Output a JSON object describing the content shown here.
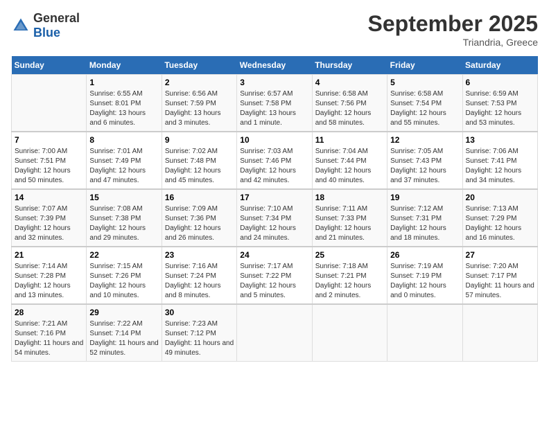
{
  "logo": {
    "general": "General",
    "blue": "Blue"
  },
  "title": "September 2025",
  "location": "Triandria, Greece",
  "days_of_week": [
    "Sunday",
    "Monday",
    "Tuesday",
    "Wednesday",
    "Thursday",
    "Friday",
    "Saturday"
  ],
  "weeks": [
    [
      {
        "day": "",
        "sunrise": "",
        "sunset": "",
        "daylight": ""
      },
      {
        "day": "1",
        "sunrise": "Sunrise: 6:55 AM",
        "sunset": "Sunset: 8:01 PM",
        "daylight": "Daylight: 13 hours and 6 minutes."
      },
      {
        "day": "2",
        "sunrise": "Sunrise: 6:56 AM",
        "sunset": "Sunset: 7:59 PM",
        "daylight": "Daylight: 13 hours and 3 minutes."
      },
      {
        "day": "3",
        "sunrise": "Sunrise: 6:57 AM",
        "sunset": "Sunset: 7:58 PM",
        "daylight": "Daylight: 13 hours and 1 minute."
      },
      {
        "day": "4",
        "sunrise": "Sunrise: 6:58 AM",
        "sunset": "Sunset: 7:56 PM",
        "daylight": "Daylight: 12 hours and 58 minutes."
      },
      {
        "day": "5",
        "sunrise": "Sunrise: 6:58 AM",
        "sunset": "Sunset: 7:54 PM",
        "daylight": "Daylight: 12 hours and 55 minutes."
      },
      {
        "day": "6",
        "sunrise": "Sunrise: 6:59 AM",
        "sunset": "Sunset: 7:53 PM",
        "daylight": "Daylight: 12 hours and 53 minutes."
      }
    ],
    [
      {
        "day": "7",
        "sunrise": "Sunrise: 7:00 AM",
        "sunset": "Sunset: 7:51 PM",
        "daylight": "Daylight: 12 hours and 50 minutes."
      },
      {
        "day": "8",
        "sunrise": "Sunrise: 7:01 AM",
        "sunset": "Sunset: 7:49 PM",
        "daylight": "Daylight: 12 hours and 47 minutes."
      },
      {
        "day": "9",
        "sunrise": "Sunrise: 7:02 AM",
        "sunset": "Sunset: 7:48 PM",
        "daylight": "Daylight: 12 hours and 45 minutes."
      },
      {
        "day": "10",
        "sunrise": "Sunrise: 7:03 AM",
        "sunset": "Sunset: 7:46 PM",
        "daylight": "Daylight: 12 hours and 42 minutes."
      },
      {
        "day": "11",
        "sunrise": "Sunrise: 7:04 AM",
        "sunset": "Sunset: 7:44 PM",
        "daylight": "Daylight: 12 hours and 40 minutes."
      },
      {
        "day": "12",
        "sunrise": "Sunrise: 7:05 AM",
        "sunset": "Sunset: 7:43 PM",
        "daylight": "Daylight: 12 hours and 37 minutes."
      },
      {
        "day": "13",
        "sunrise": "Sunrise: 7:06 AM",
        "sunset": "Sunset: 7:41 PM",
        "daylight": "Daylight: 12 hours and 34 minutes."
      }
    ],
    [
      {
        "day": "14",
        "sunrise": "Sunrise: 7:07 AM",
        "sunset": "Sunset: 7:39 PM",
        "daylight": "Daylight: 12 hours and 32 minutes."
      },
      {
        "day": "15",
        "sunrise": "Sunrise: 7:08 AM",
        "sunset": "Sunset: 7:38 PM",
        "daylight": "Daylight: 12 hours and 29 minutes."
      },
      {
        "day": "16",
        "sunrise": "Sunrise: 7:09 AM",
        "sunset": "Sunset: 7:36 PM",
        "daylight": "Daylight: 12 hours and 26 minutes."
      },
      {
        "day": "17",
        "sunrise": "Sunrise: 7:10 AM",
        "sunset": "Sunset: 7:34 PM",
        "daylight": "Daylight: 12 hours and 24 minutes."
      },
      {
        "day": "18",
        "sunrise": "Sunrise: 7:11 AM",
        "sunset": "Sunset: 7:33 PM",
        "daylight": "Daylight: 12 hours and 21 minutes."
      },
      {
        "day": "19",
        "sunrise": "Sunrise: 7:12 AM",
        "sunset": "Sunset: 7:31 PM",
        "daylight": "Daylight: 12 hours and 18 minutes."
      },
      {
        "day": "20",
        "sunrise": "Sunrise: 7:13 AM",
        "sunset": "Sunset: 7:29 PM",
        "daylight": "Daylight: 12 hours and 16 minutes."
      }
    ],
    [
      {
        "day": "21",
        "sunrise": "Sunrise: 7:14 AM",
        "sunset": "Sunset: 7:28 PM",
        "daylight": "Daylight: 12 hours and 13 minutes."
      },
      {
        "day": "22",
        "sunrise": "Sunrise: 7:15 AM",
        "sunset": "Sunset: 7:26 PM",
        "daylight": "Daylight: 12 hours and 10 minutes."
      },
      {
        "day": "23",
        "sunrise": "Sunrise: 7:16 AM",
        "sunset": "Sunset: 7:24 PM",
        "daylight": "Daylight: 12 hours and 8 minutes."
      },
      {
        "day": "24",
        "sunrise": "Sunrise: 7:17 AM",
        "sunset": "Sunset: 7:22 PM",
        "daylight": "Daylight: 12 hours and 5 minutes."
      },
      {
        "day": "25",
        "sunrise": "Sunrise: 7:18 AM",
        "sunset": "Sunset: 7:21 PM",
        "daylight": "Daylight: 12 hours and 2 minutes."
      },
      {
        "day": "26",
        "sunrise": "Sunrise: 7:19 AM",
        "sunset": "Sunset: 7:19 PM",
        "daylight": "Daylight: 12 hours and 0 minutes."
      },
      {
        "day": "27",
        "sunrise": "Sunrise: 7:20 AM",
        "sunset": "Sunset: 7:17 PM",
        "daylight": "Daylight: 11 hours and 57 minutes."
      }
    ],
    [
      {
        "day": "28",
        "sunrise": "Sunrise: 7:21 AM",
        "sunset": "Sunset: 7:16 PM",
        "daylight": "Daylight: 11 hours and 54 minutes."
      },
      {
        "day": "29",
        "sunrise": "Sunrise: 7:22 AM",
        "sunset": "Sunset: 7:14 PM",
        "daylight": "Daylight: 11 hours and 52 minutes."
      },
      {
        "day": "30",
        "sunrise": "Sunrise: 7:23 AM",
        "sunset": "Sunset: 7:12 PM",
        "daylight": "Daylight: 11 hours and 49 minutes."
      },
      {
        "day": "",
        "sunrise": "",
        "sunset": "",
        "daylight": ""
      },
      {
        "day": "",
        "sunrise": "",
        "sunset": "",
        "daylight": ""
      },
      {
        "day": "",
        "sunrise": "",
        "sunset": "",
        "daylight": ""
      },
      {
        "day": "",
        "sunrise": "",
        "sunset": "",
        "daylight": ""
      }
    ]
  ]
}
